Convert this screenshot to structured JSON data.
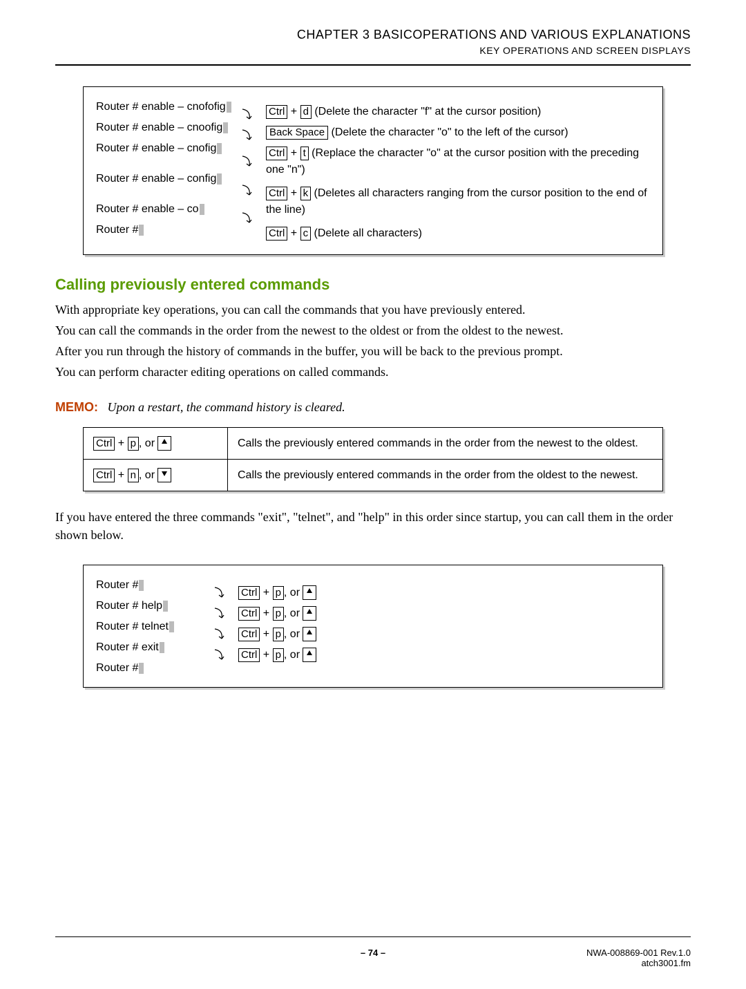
{
  "header": {
    "chapter": "CHAPTER 3   BASICOPERATIONS AND VARIOUS EXPLANATIONS",
    "sub": "KEY OPERATIONS AND SCREEN DISPLAYS"
  },
  "panel1": {
    "prompts": [
      "Router # enable – cnofofig",
      "Router # enable – cnoofig",
      "Router # enable – cnofig",
      "Router # enable – config",
      "Router # enable – co",
      "Router #"
    ],
    "entries": [
      {
        "keys": [
          "Ctrl",
          "d"
        ],
        "plus": true,
        "desc": "(Delete the character \"f\" at the cursor position)"
      },
      {
        "keys": [
          "Back Space"
        ],
        "plus": false,
        "desc": "(Delete the character \"o\" to the left of the cursor)"
      },
      {
        "keys": [
          "Ctrl",
          "t"
        ],
        "plus": true,
        "desc": "(Replace the character \"o\" at the cursor position with the preceding one \"n\")"
      },
      {
        "keys": [
          "Ctrl",
          "k"
        ],
        "plus": true,
        "desc": "(Deletes all characters ranging from the cursor position to the end of the line)"
      },
      {
        "keys": [
          "Ctrl",
          "c"
        ],
        "plus": true,
        "desc": "(Delete all characters)"
      }
    ]
  },
  "section": {
    "title": "Calling previously entered commands",
    "p1": "With appropriate key operations, you can call the commands that you have previously entered.",
    "p2": "You can call the commands in the order from the newest to the oldest or from the oldest to the newest.",
    "p3": "After you run through the history of commands in the buffer, you will be back to the previous prompt.",
    "p4": "You can perform character editing operations on called commands."
  },
  "memo": {
    "label": "MEMO:",
    "text": "Upon a restart, the command history is cleared."
  },
  "keytable": {
    "rows": [
      {
        "k1": "Ctrl",
        "k2": "p",
        "arrowdir": "up",
        "desc": "Calls the previously entered commands in the order from the newest to the oldest."
      },
      {
        "k1": "Ctrl",
        "k2": "n",
        "arrowdir": "down",
        "desc": "Calls the previously entered commands in the order from the oldest to the newest."
      }
    ]
  },
  "after_table": "If you have entered the three commands \"exit\", \"telnet\", and \"help\" in this order since startup, you can call them in the order shown below.",
  "panel2": {
    "prompts": [
      "Router #",
      "Router # help",
      "Router # telnet",
      "Router # exit",
      "Router #"
    ],
    "key_rows": 4,
    "k1": "Ctrl",
    "k2": "p"
  },
  "footer": {
    "page": "– 74 –",
    "right1": "NWA-008869-001 Rev.1.0",
    "right2": "atch3001.fm"
  }
}
